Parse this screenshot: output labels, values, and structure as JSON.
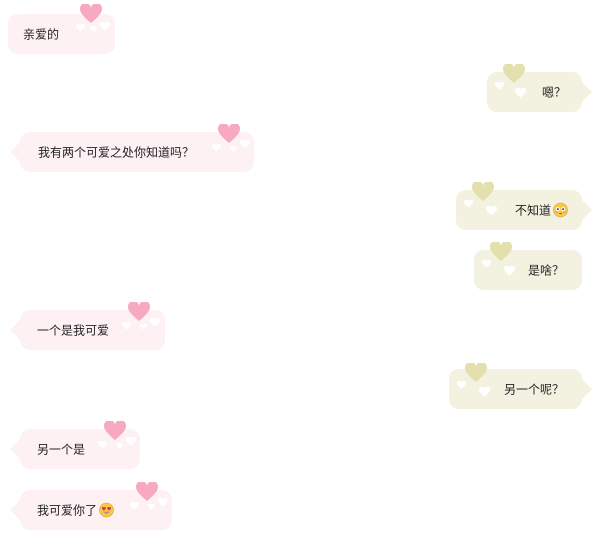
{
  "colors": {
    "left_bubble": "#fdf1f4",
    "right_bubble": "#f3f1df",
    "left_heart": "#f7a9bf",
    "right_heart": "#e3e0ad",
    "small_heart": "#ffffff"
  },
  "messages": [
    {
      "side": "left",
      "text": "亲爱的"
    },
    {
      "side": "right",
      "text": "嗯？"
    },
    {
      "side": "left",
      "text": "我有两个可爱之处你知道吗？"
    },
    {
      "side": "right",
      "text": "不知道",
      "emoji": "flushed-face-emoji"
    },
    {
      "side": "right",
      "text": "是啥？"
    },
    {
      "side": "left",
      "text": "一个是我可爱"
    },
    {
      "side": "right",
      "text": "另一个呢？"
    },
    {
      "side": "left",
      "text": "另一个是"
    },
    {
      "side": "left",
      "text": "我可爱你了",
      "emoji": "heart-eyes-emoji"
    }
  ]
}
